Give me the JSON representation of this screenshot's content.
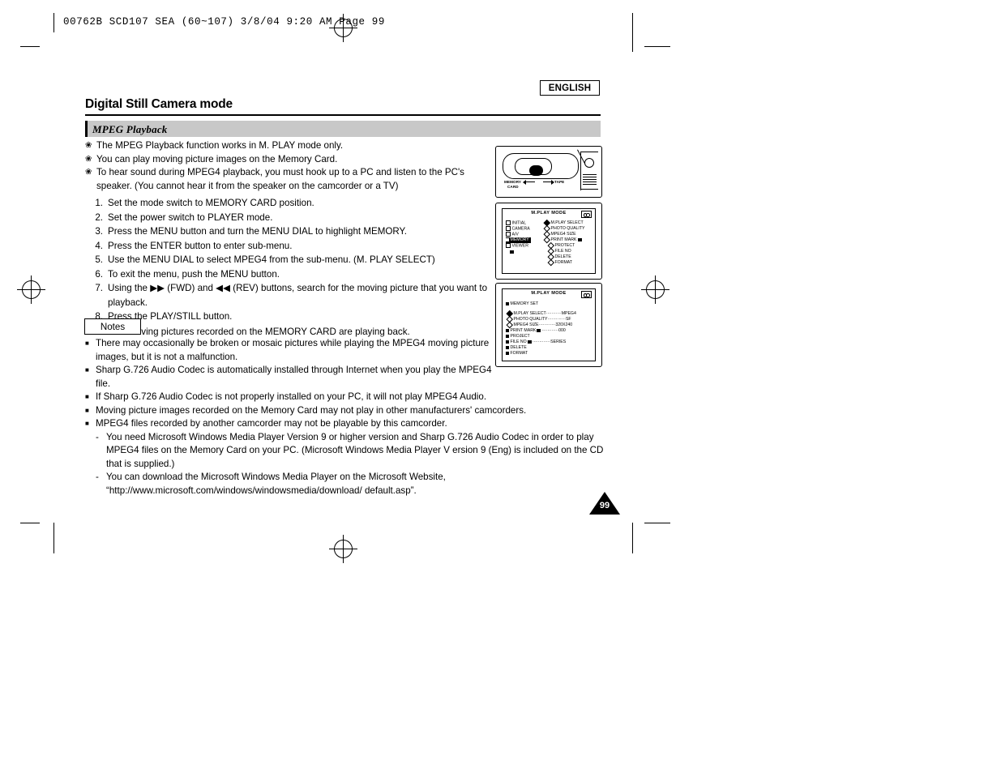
{
  "print_marks": {
    "slugline": "00762B  SCD107  SEA  (60~107)    3/8/04 9:20 AM    Page 99"
  },
  "header": {
    "english_badge": "ENGLISH",
    "page_title": "Digital Still Camera mode"
  },
  "section": {
    "label": "MPEG Playback"
  },
  "bullets": [
    {
      "mark": "❀",
      "text": "The MPEG Playback function works in M. PLAY mode only."
    },
    {
      "mark": "❀",
      "text": "You can play moving picture images on the Memory Card."
    },
    {
      "mark": "❀",
      "text": "To hear sound during MPEG4 playback, you must hook up to a PC and listen to the PC's"
    },
    {
      "mark": "",
      "text": "speaker. (You cannot hear it from the speaker on the camcorder or a TV)"
    }
  ],
  "steps": [
    {
      "num": "1.",
      "text": "Set the mode switch to MEMORY CARD position."
    },
    {
      "num": "2.",
      "text": "Set the power switch to PLAYER mode."
    },
    {
      "num": "3.",
      "text": "Press the MENU button and turn the MENU DIAL to highlight MEMORY."
    },
    {
      "num": "4.",
      "text": "Press the ENTER button to enter sub-menu."
    },
    {
      "num": "5.",
      "text": "Use the MENU DIAL to select MPEG4 from the sub-menu. (M. PLAY SELECT)"
    },
    {
      "num": "6.",
      "text": "To exit the menu, push the MENU button."
    },
    {
      "num": "7.",
      "text": "Using the ▶▶ (FWD) and  ◀◀ (REV) buttons, search for the moving picture that you want to"
    },
    {
      "num": "",
      "text": "playback."
    },
    {
      "num": "8.",
      "text": "Press the PLAY/STILL button."
    }
  ],
  "step_sub": {
    "mark": "■",
    "text": "The moving pictures recorded on the MEMORY CARD are playing back."
  },
  "notes_label": "Notes",
  "notes": [
    {
      "type": "square",
      "mark": "■",
      "text": "There may occasionally be broken or mosaic pictures while playing the MPEG4 moving picture"
    },
    {
      "type": "cont",
      "mark": "",
      "text": "images, but it is not a malfunction."
    },
    {
      "type": "square",
      "mark": "■",
      "text": "Sharp G.726 Audio Codec is automatically installed through Internet when you play the MPEG4"
    },
    {
      "type": "cont",
      "mark": "",
      "text": "file."
    },
    {
      "type": "square",
      "mark": "■",
      "text": "If Sharp G.726 Audio Codec is not properly installed on your PC, it will not play MPEG4 Audio."
    },
    {
      "type": "square",
      "mark": "■",
      "text": "Moving picture images recorded on the Memory Card may not play in other manufacturers' camcorders."
    },
    {
      "type": "square",
      "mark": "■",
      "text": "MPEG4 files recorded by another camcorder may not be playable by this camcorder."
    },
    {
      "type": "dash",
      "mark": "-",
      "text": "You need Microsoft Windows Media Player Version 9 or higher version and Sharp G.726 Audio Codec in order to play"
    },
    {
      "type": "dashcont",
      "mark": "",
      "text": "MPEG4 files on the Memory Card on your PC. (Microsoft Windows Media Player V ersion 9 (Eng) is included on the CD"
    },
    {
      "type": "dashcont",
      "mark": "",
      "text": "that is supplied.)"
    },
    {
      "type": "dash",
      "mark": "-",
      "text": "You can download the Microsoft Windows Media Player on the Microsoft Website,"
    },
    {
      "type": "dashcont",
      "mark": "",
      "text": "“http://www.microsoft.com/windows/windowsmedia/download/ default.asp”."
    }
  ],
  "page_number": "99",
  "figures": {
    "mode_switch": {
      "label_memory": "MEMORY",
      "label_card": "CARD",
      "label_tape": "TAPE"
    },
    "menu_screen_1": {
      "title": "M.PLAY MODE",
      "left_items": [
        {
          "text": "INITIAL",
          "selected": false
        },
        {
          "text": "CAMERA",
          "selected": false
        },
        {
          "text": "A/V",
          "selected": false
        },
        {
          "text": "MEMORY",
          "selected": true
        },
        {
          "text": "VIEWER",
          "selected": false
        }
      ],
      "right_items": [
        "M.PLAY SELECT",
        "PHOTO QUALITY",
        "MPEG4 SIZE",
        "PRINT MARK",
        "PROTECT",
        "FILE NO",
        "DELETE",
        "FORMAT"
      ]
    },
    "menu_screen_2": {
      "title": "M.PLAY MODE",
      "header": "MEMORY SET",
      "rows": [
        {
          "label": "M.PLAY SELECT",
          "dots": "···········",
          "value": "MPEG4",
          "selected": true
        },
        {
          "label": "PHOTO QUALITY",
          "dots": "·············",
          "value": "SF",
          "selected": false
        },
        {
          "label": "MPEG4 SIZE",
          "dots": "············",
          "value": "320X240",
          "selected": false
        },
        {
          "label": "PRINT MARK",
          "dots": "············",
          "value": "000",
          "selected": false
        },
        {
          "label": "PROJECT",
          "dots": "",
          "value": "",
          "selected": false
        },
        {
          "label": "FILE NO",
          "dots": "·············",
          "value": "SERIES",
          "selected": false
        },
        {
          "label": "DELETE",
          "dots": "",
          "value": "",
          "selected": false
        },
        {
          "label": "FORMAT",
          "dots": "",
          "value": "",
          "selected": false
        }
      ]
    }
  }
}
